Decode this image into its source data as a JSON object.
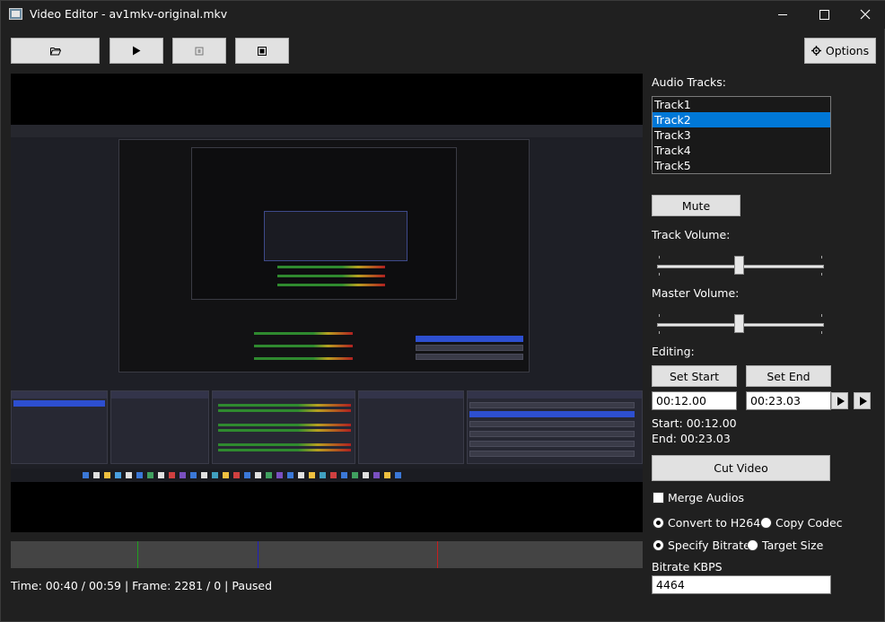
{
  "window": {
    "title": "Video Editor - av1mkv-original.mkv"
  },
  "toolbar": {
    "open_icon": "folder-open-icon",
    "play_icon": "play-icon",
    "pause_icon": "pause-icon",
    "stop_icon": "stop-icon",
    "options_icon": "gear-icon",
    "options_label": "Options"
  },
  "audio": {
    "tracks_label": "Audio Tracks:",
    "tracks": [
      "Track1",
      "Track2",
      "Track3",
      "Track4",
      "Track5"
    ],
    "selected_track": "Track2",
    "mute_label": "Mute",
    "track_volume_label": "Track Volume:",
    "track_volume_value": 0.49,
    "master_volume_label": "Master Volume:",
    "master_volume_value": 0.49
  },
  "editing": {
    "label": "Editing:",
    "set_start_label": "Set Start",
    "set_end_label": "Set End",
    "start_field": "00:12.00",
    "end_field": "00:23.03",
    "start_text": "Start: 00:12.00",
    "end_text": "End: 00:23.03",
    "cut_label": "Cut Video"
  },
  "options": {
    "merge_audios_label": "Merge Audios",
    "merge_audios_checked": false,
    "convert_h264_label": "Convert to H264",
    "copy_codec_label": "Copy Codec",
    "codec_choice": "Convert to H264",
    "specify_bitrate_label": "Specify Bitrate",
    "target_size_label": "Target Size",
    "size_choice": "Specify Bitrate",
    "bitrate_label": "Bitrate KBPS",
    "bitrate_value": "4464"
  },
  "timeline": {
    "markers": [
      {
        "name": "start-marker",
        "color": "#1fa01f",
        "position": 0.2
      },
      {
        "name": "playhead-marker",
        "color": "#2020c0",
        "position": 0.39
      },
      {
        "name": "end-marker",
        "color": "#c81e1e",
        "position": 0.675
      }
    ]
  },
  "status": {
    "text": "Time: 00:40 / 00:59 | Frame: 2281 / 0 | Paused"
  },
  "colors": {
    "background": "#202020",
    "selection": "#0078d7",
    "button": "#e1e1e1"
  }
}
